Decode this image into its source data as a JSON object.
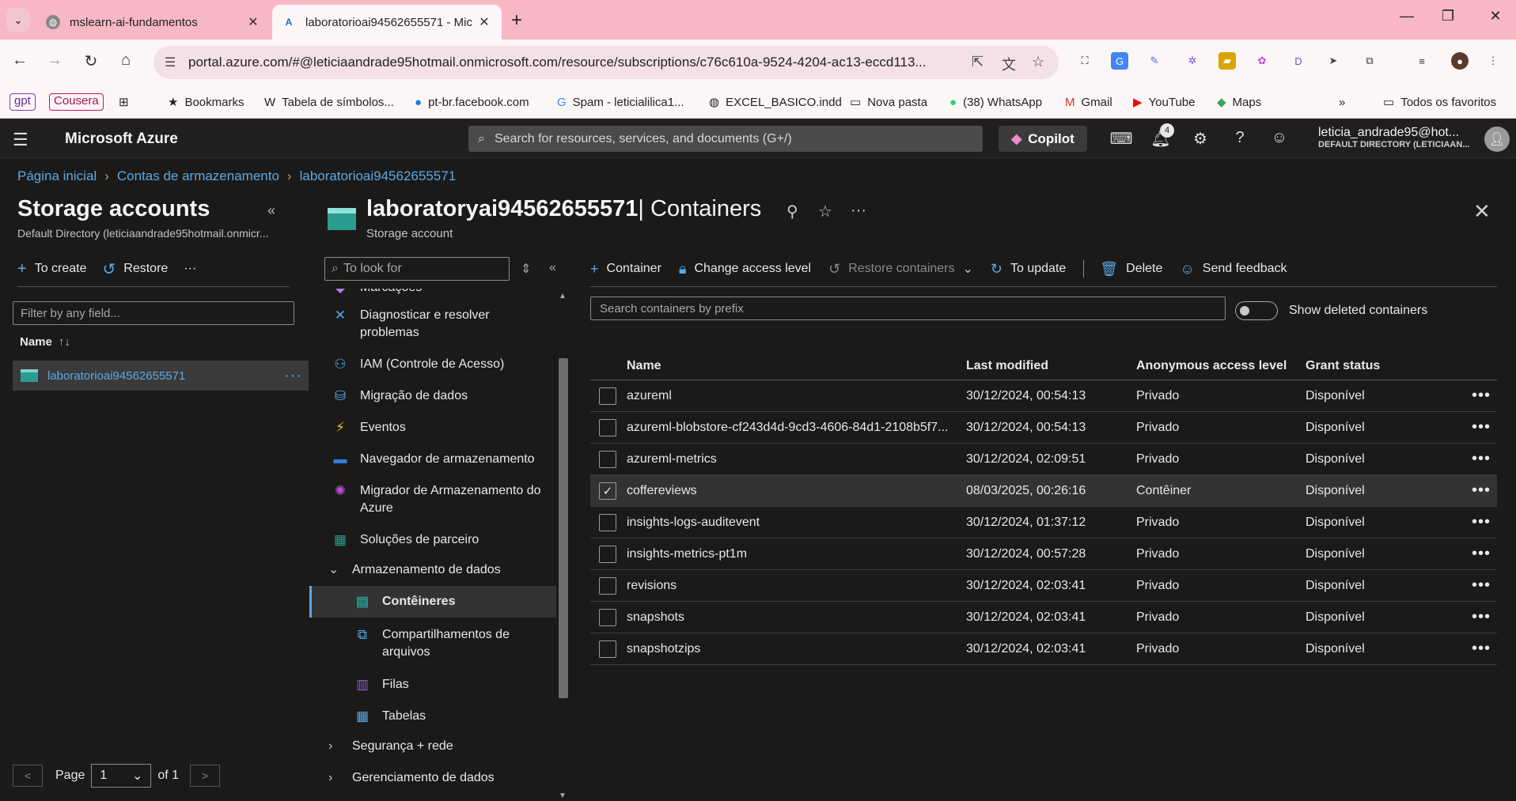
{
  "browser": {
    "tabs": [
      {
        "title": "mslearn-ai-fundamentos",
        "active": false
      },
      {
        "title": "laboratorioai94562655571 - Mic",
        "active": true
      }
    ],
    "url": "portal.azure.com/#@leticiaandrade95hotmail.onmicrosoft.com/resource/subscriptions/c76c610a-9524-4204-ac13-eccd113...",
    "bookmarks": {
      "gpt": "gpt",
      "cousera": "Cousera",
      "items": [
        "Bookmarks",
        "Tabela de símbolos...",
        "pt-br.facebook.com",
        "Spam - leticialilica1...",
        "EXCEL_BASICO.indd",
        "Nova pasta",
        "(38) WhatsApp",
        "Gmail",
        "YouTube",
        "Maps"
      ],
      "all": "Todos os favoritos"
    },
    "chrome_color": "#f7b7c4"
  },
  "azure": {
    "brand": "Microsoft Azure",
    "search_placeholder": "Search for resources, services, and documents (G+/)",
    "copilot": "Copilot",
    "notifications": "4",
    "user_name": "leticia_andrade95@hot...",
    "user_dir": "DEFAULT DIRECTORY (LETICIAAN..."
  },
  "breadcrumb": [
    "Página inicial",
    "Contas de armazenamento",
    "laboratorioai94562655571"
  ],
  "left": {
    "title": "Storage accounts",
    "subtitle": "Default Directory (leticiaandrade95hotmail.onmicr...",
    "create": "To create",
    "restore": "Restore",
    "filter_placeholder": "Filter by any field...",
    "name_header": "Name",
    "resource": "laboratorioai94562655571",
    "page_label": "Page",
    "page_value": "1",
    "of_label": "of 1"
  },
  "resource": {
    "title_main": "laboratoryai94562655571",
    "title_suffix": "| Containers",
    "subtitle": "Storage account"
  },
  "menu": {
    "search_placeholder": "To look for",
    "partial_top": "Marcações",
    "items": {
      "diagnose": "Diagnosticar e resolver problemas",
      "iam": "IAM (Controle de Acesso)",
      "migration": "Migração de dados",
      "events": "Eventos",
      "browser": "Navegador de armazenamento",
      "migrator": "Migrador de Armazenamento do Azure",
      "partners": "Soluções de parceiro",
      "data_storage": "Armazenamento de dados",
      "containers": "Contêineres",
      "file_shares": "Compartilhamentos de arquivos",
      "queues": "Filas",
      "tables": "Tabelas",
      "security": "Segurança + rede",
      "data_mgmt": "Gerenciamento de dados"
    }
  },
  "commands": {
    "container": "Container",
    "change_access": "Change access level",
    "restore": "Restore containers",
    "update": "To update",
    "delete": "Delete",
    "feedback": "Send feedback"
  },
  "filters": {
    "prefix_placeholder": "Search containers by prefix",
    "show_deleted": "Show deleted containers"
  },
  "table": {
    "headers": {
      "name": "Name",
      "modified": "Last modified",
      "access": "Anonymous access level",
      "grant": "Grant status"
    },
    "rows": [
      {
        "name": "azureml",
        "modified": "30/12/2024, 00:54:13",
        "access": "Privado",
        "grant": "Disponível",
        "checked": false
      },
      {
        "name": "azureml-blobstore-cf243d4d-9cd3-4606-84d1-2108b5f7...",
        "modified": "30/12/2024, 00:54:13",
        "access": "Privado",
        "grant": "Disponível",
        "checked": false
      },
      {
        "name": "azureml-metrics",
        "modified": "30/12/2024, 02:09:51",
        "access": "Privado",
        "grant": "Disponível",
        "checked": false
      },
      {
        "name": "coffereviews",
        "modified": "08/03/2025, 00:26:16",
        "access": "Contêiner",
        "grant": "Disponível",
        "checked": true
      },
      {
        "name": "insights-logs-auditevent",
        "modified": "30/12/2024, 01:37:12",
        "access": "Privado",
        "grant": "Disponível",
        "checked": false
      },
      {
        "name": "insights-metrics-pt1m",
        "modified": "30/12/2024, 00:57:28",
        "access": "Privado",
        "grant": "Disponível",
        "checked": false
      },
      {
        "name": "revisions",
        "modified": "30/12/2024, 02:03:41",
        "access": "Privado",
        "grant": "Disponível",
        "checked": false
      },
      {
        "name": "snapshots",
        "modified": "30/12/2024, 02:03:41",
        "access": "Privado",
        "grant": "Disponível",
        "checked": false
      },
      {
        "name": "snapshotzips",
        "modified": "30/12/2024, 02:03:41",
        "access": "Privado",
        "grant": "Disponível",
        "checked": false
      }
    ]
  },
  "colors": {
    "accent": "#5aa9e6",
    "background": "#1b1a19",
    "storage": "#2a9d8f"
  }
}
